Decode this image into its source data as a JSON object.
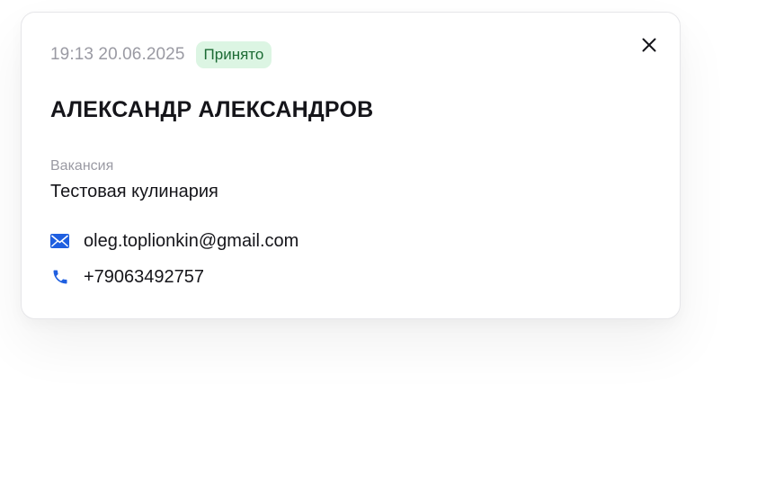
{
  "card": {
    "timestamp": "19:13 20.06.2025",
    "status": "Принято",
    "candidate_name": "АЛЕКСАНДР АЛЕКСАНДРОВ",
    "vacancy_label": "Вакансия",
    "vacancy_value": "Тестовая кулинария",
    "email": "oleg.toplionkin@gmail.com",
    "phone": "+79063492757"
  },
  "icons": {
    "close": "close-icon",
    "email": "mail-icon",
    "phone": "phone-icon"
  },
  "colors": {
    "accent": "#1f5fe0",
    "status_bg": "#dcf5e3",
    "status_text": "#1c6b34",
    "muted_text": "#9a9aa3",
    "primary_text": "#15151a"
  }
}
